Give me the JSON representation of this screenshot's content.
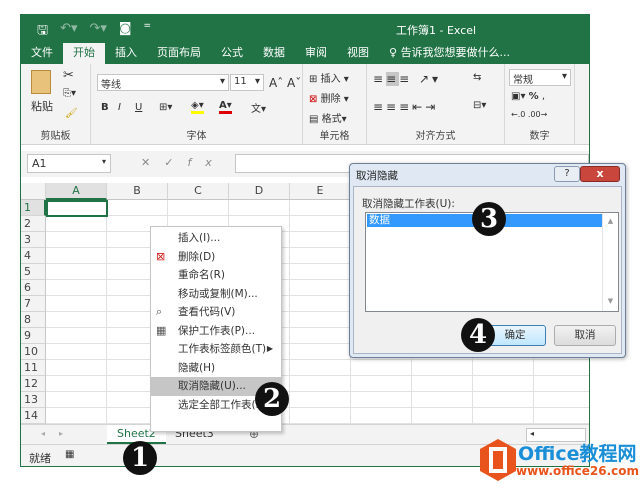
{
  "window": {
    "title": "工作簿1 - Excel"
  },
  "ribbon_tabs": [
    "文件",
    "开始",
    "插入",
    "页面布局",
    "公式",
    "数据",
    "审阅",
    "视图"
  ],
  "tell_me": "告诉我您想要做什么...",
  "ribbon": {
    "clipboard": {
      "paste": "粘贴",
      "label": "剪贴板"
    },
    "font": {
      "name": "等线",
      "size": "11",
      "bold": "B",
      "italic": "I",
      "underline": "U",
      "label": "字体"
    },
    "cells": {
      "insert": "插入",
      "delete": "删除",
      "format": "格式",
      "label": "单元格"
    },
    "alignment": {
      "label": "对齐方式"
    },
    "number": {
      "format": "常规",
      "percent": "%",
      "label": "数字"
    }
  },
  "formula_bar": {
    "name_box": "A1",
    "fx": "fx"
  },
  "columns": [
    "A",
    "B",
    "C",
    "D",
    "E"
  ],
  "rows": [
    "1",
    "2",
    "3",
    "4",
    "5",
    "6",
    "7",
    "8",
    "9",
    "10",
    "11",
    "12",
    "13",
    "14"
  ],
  "context_menu": [
    {
      "label": "插入(I)...",
      "icon": ""
    },
    {
      "label": "删除(D)",
      "icon": "delete-sheet-icon"
    },
    {
      "label": "重命名(R)",
      "icon": ""
    },
    {
      "label": "移动或复制(M)...",
      "icon": ""
    },
    {
      "label": "查看代码(V)",
      "icon": "view-code-icon"
    },
    {
      "label": "保护工作表(P)...",
      "icon": "protect-sheet-icon"
    },
    {
      "label": "工作表标签颜色(T)",
      "icon": "",
      "submenu": true
    },
    {
      "label": "隐藏(H)",
      "icon": ""
    },
    {
      "label": "取消隐藏(U)...",
      "icon": "",
      "highlighted": true
    },
    {
      "label": "选定全部工作表(S)",
      "icon": ""
    }
  ],
  "sheet_tabs": [
    "Sheet2",
    "Sheet3"
  ],
  "status": {
    "ready": "就绪"
  },
  "dialog": {
    "title": "取消隐藏",
    "help": "?",
    "close": "x",
    "label": "取消隐藏工作表(U):",
    "items": [
      "数据"
    ],
    "ok": "确定",
    "cancel": "取消"
  },
  "steps": [
    "1",
    "2",
    "3",
    "4"
  ],
  "watermark": {
    "brand": "Office教程网",
    "url": "www.office26.com"
  },
  "colors": {
    "excel_green": "#217346",
    "selection": "#3399ff",
    "watermark_orange": "#e8541c"
  }
}
